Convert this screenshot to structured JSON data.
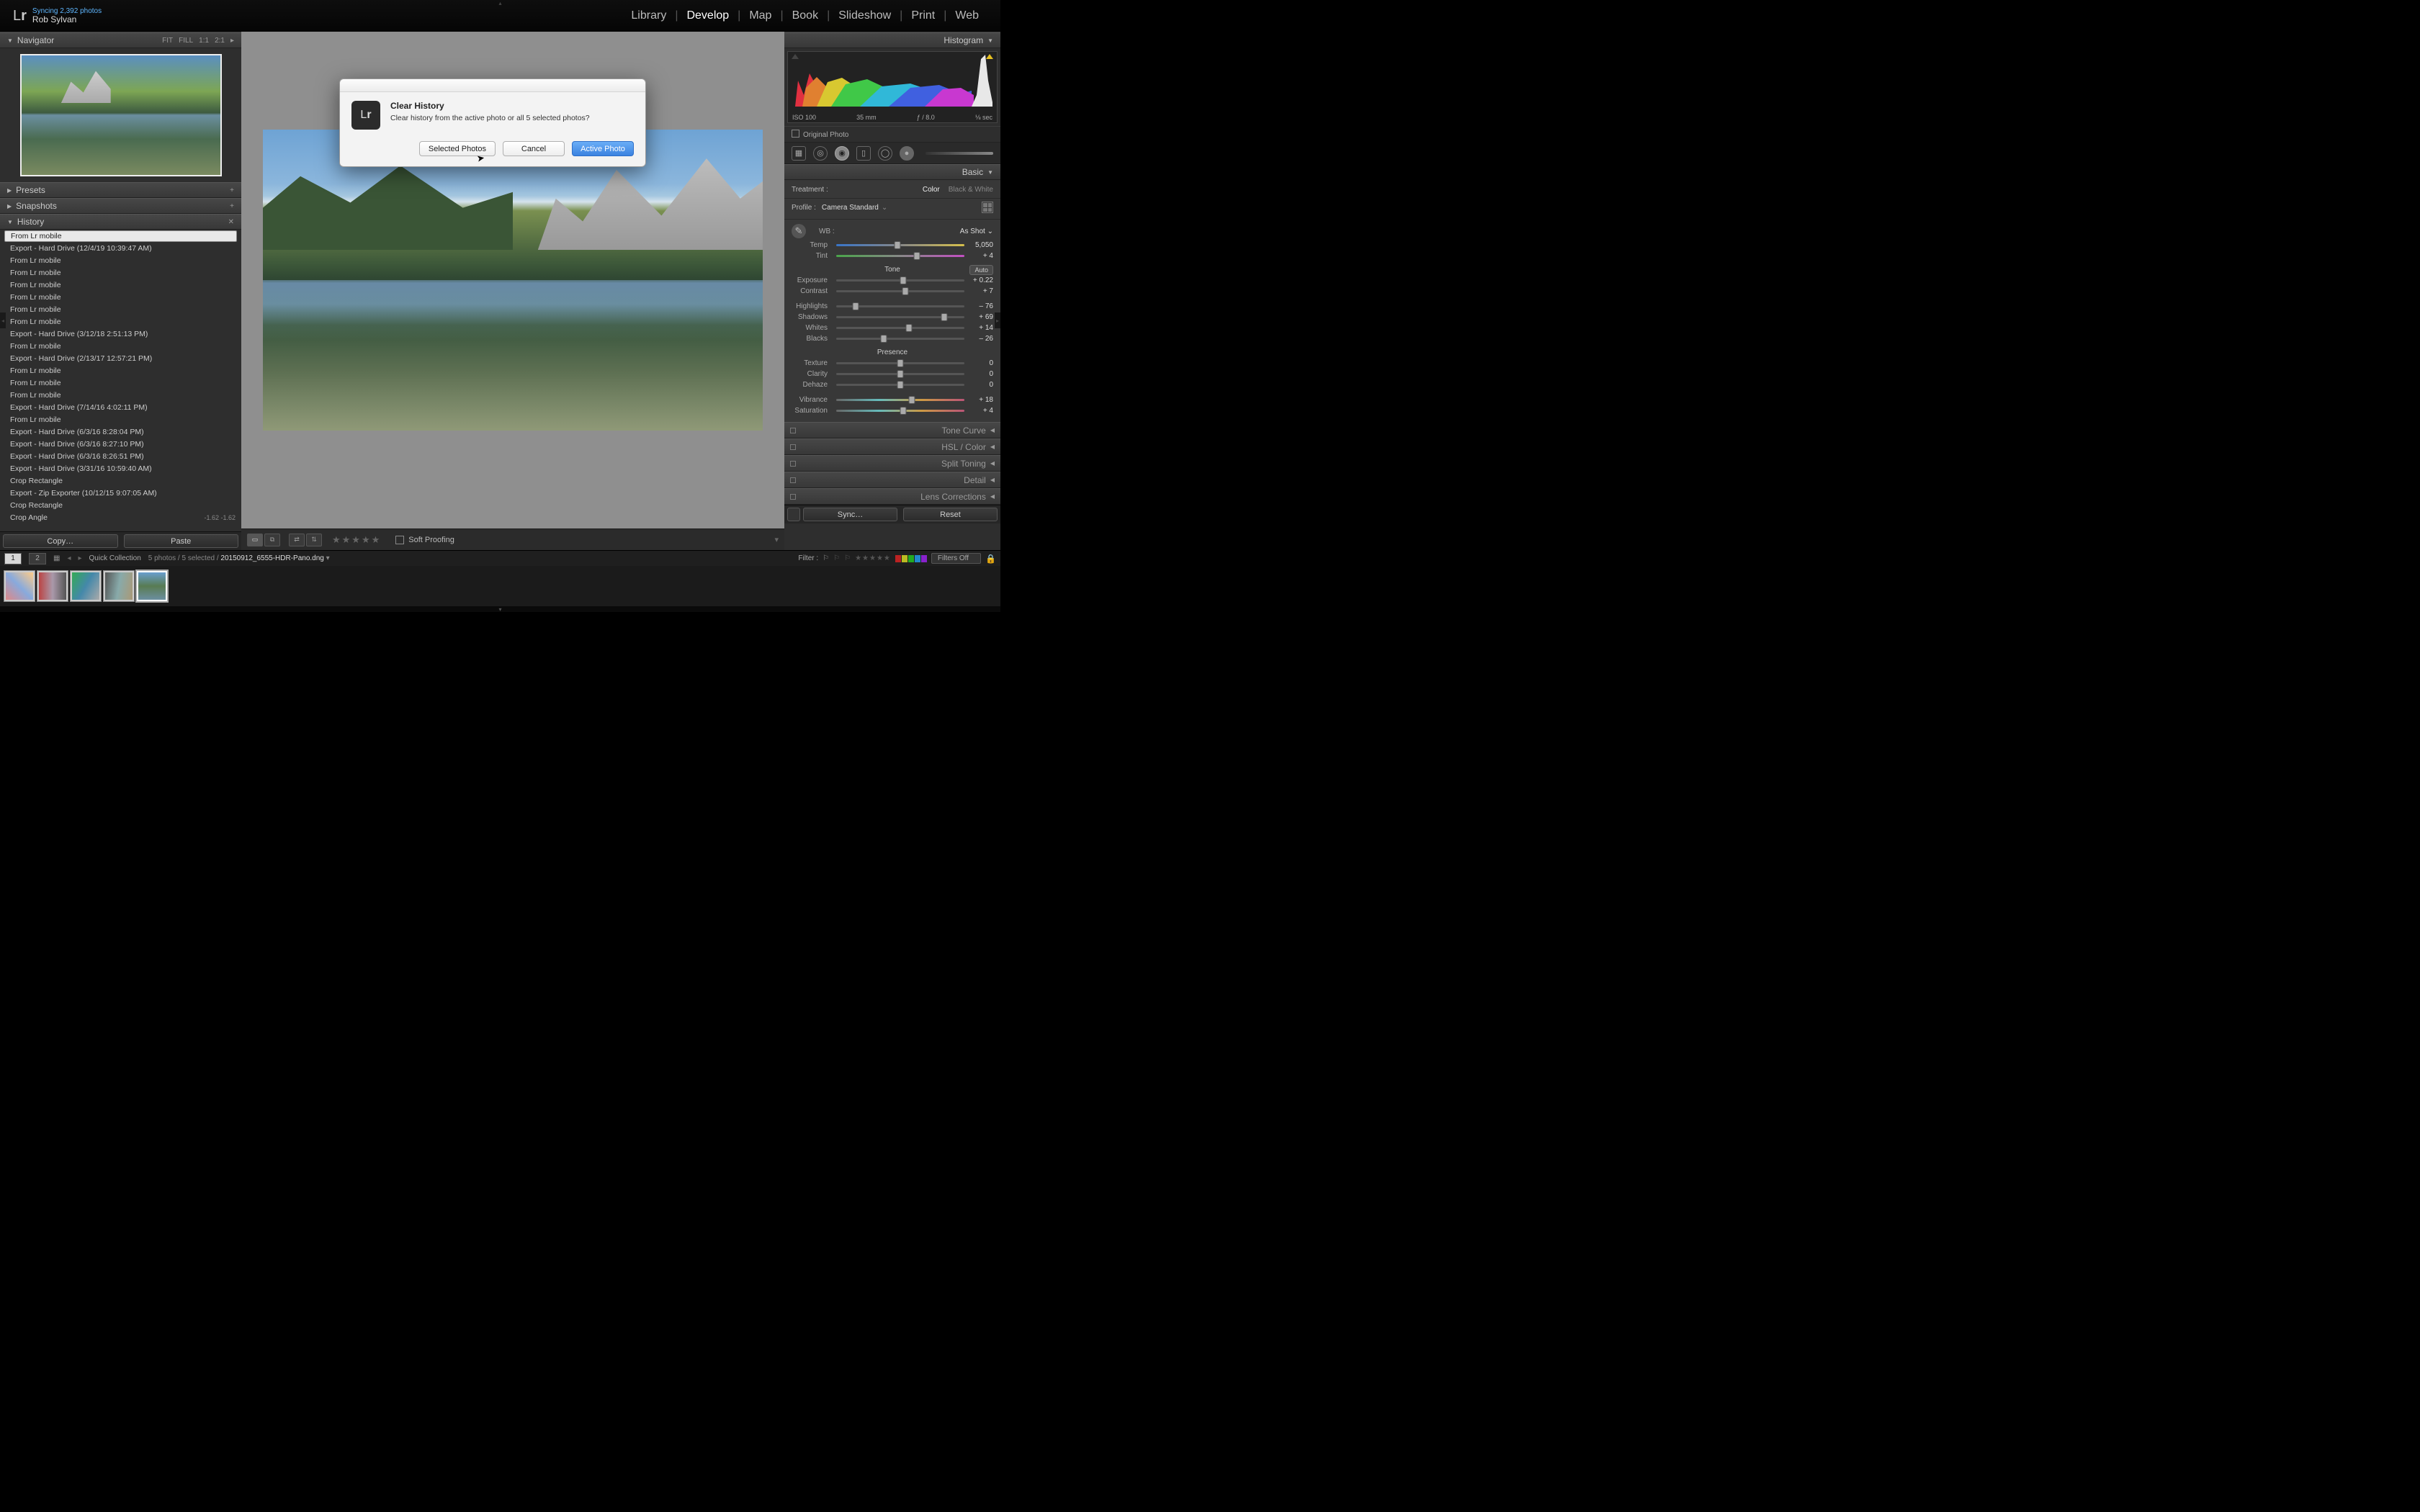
{
  "app": {
    "logo_l": "L",
    "logo_r": "r",
    "sync_status": "Syncing 2,392 photos",
    "user": "Rob Sylvan"
  },
  "modules": {
    "items": [
      "Library",
      "Develop",
      "Map",
      "Book",
      "Slideshow",
      "Print",
      "Web"
    ],
    "active": "Develop"
  },
  "navigator": {
    "title": "Navigator",
    "modes": [
      "FIT",
      "FILL",
      "1:1",
      "2:1"
    ]
  },
  "presets": {
    "title": "Presets"
  },
  "snapshots": {
    "title": "Snapshots"
  },
  "history": {
    "title": "History",
    "items": [
      {
        "t": "From Lr mobile",
        "sel": true
      },
      {
        "t": "Export - Hard Drive (12/4/19 10:39:47 AM)"
      },
      {
        "t": "From Lr mobile"
      },
      {
        "t": "From Lr mobile"
      },
      {
        "t": "From Lr mobile"
      },
      {
        "t": "From Lr mobile"
      },
      {
        "t": "From Lr mobile"
      },
      {
        "t": "From Lr mobile"
      },
      {
        "t": "Export - Hard Drive (3/12/18 2:51:13 PM)"
      },
      {
        "t": "From Lr mobile"
      },
      {
        "t": "Export - Hard Drive (2/13/17 12:57:21 PM)"
      },
      {
        "t": "From Lr mobile"
      },
      {
        "t": "From Lr mobile"
      },
      {
        "t": "From Lr mobile"
      },
      {
        "t": "Export - Hard Drive (7/14/16 4:02:11 PM)"
      },
      {
        "t": "From Lr mobile"
      },
      {
        "t": "Export - Hard Drive (6/3/16 8:28:04 PM)"
      },
      {
        "t": "Export - Hard Drive (6/3/16 8:27:10 PM)"
      },
      {
        "t": "Export - Hard Drive (6/3/16 8:26:51 PM)"
      },
      {
        "t": "Export - Hard Drive (3/31/16 10:59:40 AM)"
      },
      {
        "t": "Crop Rectangle"
      },
      {
        "t": "Export - Zip Exporter (10/12/15 9:07:05 AM)"
      },
      {
        "t": "Crop Rectangle"
      },
      {
        "t": "Crop Angle",
        "v": "-1.62  -1.62"
      }
    ]
  },
  "left_btns": {
    "copy": "Copy…",
    "paste": "Paste"
  },
  "histogram": {
    "title": "Histogram",
    "iso": "ISO 100",
    "focal": "35 mm",
    "aperture": "ƒ / 8.0",
    "shutter": "⅛ sec",
    "original": "Original Photo"
  },
  "basic": {
    "title": "Basic",
    "treatment_label": "Treatment :",
    "treat_color": "Color",
    "treat_bw": "Black & White",
    "profile_label": "Profile :",
    "profile_value": "Camera Standard",
    "wb_label": "WB :",
    "wb_value": "As Shot",
    "temp": {
      "l": "Temp",
      "v": "5,050",
      "p": 48
    },
    "tint": {
      "l": "Tint",
      "v": "+ 4",
      "p": 63
    },
    "tone_hdr": "Tone",
    "auto": "Auto",
    "exposure": {
      "l": "Exposure",
      "v": "+ 0.22",
      "p": 52
    },
    "contrast": {
      "l": "Contrast",
      "v": "+ 7",
      "p": 54
    },
    "highlights": {
      "l": "Highlights",
      "v": "– 76",
      "p": 15
    },
    "shadows": {
      "l": "Shadows",
      "v": "+ 69",
      "p": 84
    },
    "whites": {
      "l": "Whites",
      "v": "+ 14",
      "p": 57
    },
    "blacks": {
      "l": "Blacks",
      "v": "– 26",
      "p": 37
    },
    "presence_hdr": "Presence",
    "texture": {
      "l": "Texture",
      "v": "0",
      "p": 50
    },
    "clarity": {
      "l": "Clarity",
      "v": "0",
      "p": 50
    },
    "dehaze": {
      "l": "Dehaze",
      "v": "0",
      "p": 50
    },
    "vibrance": {
      "l": "Vibrance",
      "v": "+ 18",
      "p": 59
    },
    "saturation": {
      "l": "Saturation",
      "v": "+ 4",
      "p": 52
    }
  },
  "collapsed_panels": [
    "Tone Curve",
    "HSL / Color",
    "Split Toning",
    "Detail",
    "Lens Corrections"
  ],
  "right_btns": {
    "sync": "Sync…",
    "reset": "Reset"
  },
  "center_toolbar": {
    "soft_proof": "Soft Proofing"
  },
  "secbar": {
    "tabs": [
      "1",
      "2"
    ],
    "quick": "Quick Collection",
    "count": "5 photos / 5 selected /",
    "file": "20150912_6555-HDR-Pano.dng",
    "filter_label": "Filter :",
    "filters_off": "Filters Off",
    "label_colors": [
      "#b22",
      "#bb2",
      "#2a2",
      "#28c",
      "#82c"
    ]
  },
  "dialog": {
    "title": "Clear History",
    "message": "Clear history from the active photo or all 5 selected photos?",
    "btn_selected": "Selected Photos",
    "btn_cancel": "Cancel",
    "btn_active": "Active Photo"
  }
}
